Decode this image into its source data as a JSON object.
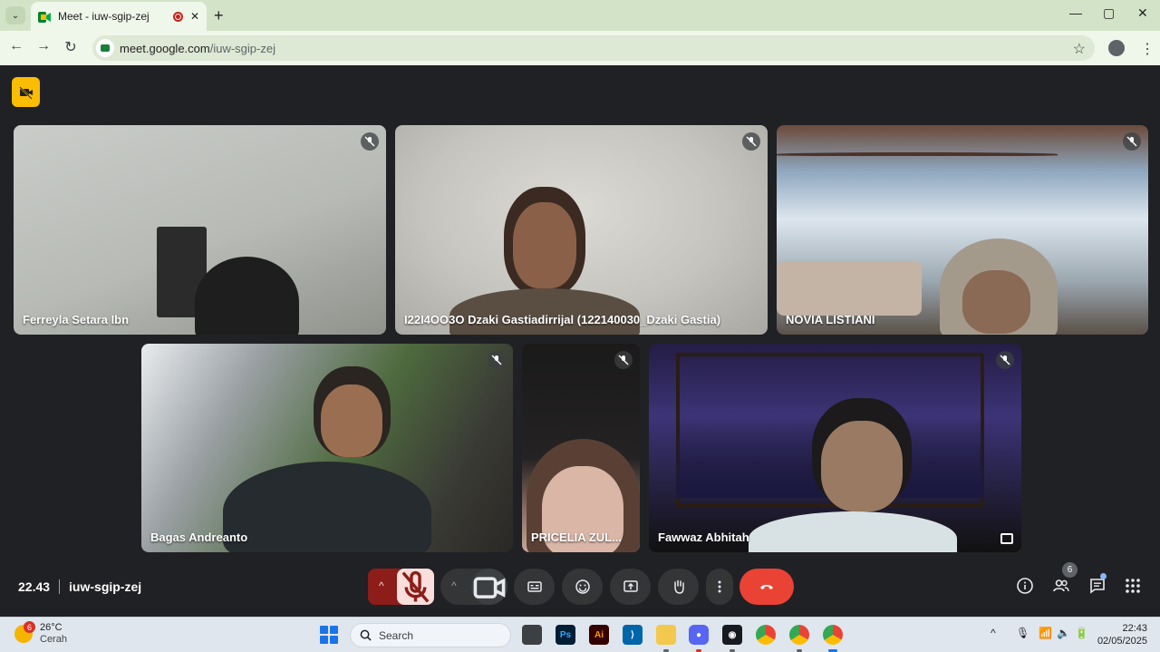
{
  "browser": {
    "tab_title": "Meet - iuw-sgip-zej",
    "url_host": "meet.google.com",
    "url_path": "/iuw-sgip-zej",
    "tab_close": "✕",
    "new_tab": "+",
    "minimize": "—",
    "maximize": "▢",
    "close_window": "✕"
  },
  "meet": {
    "time": "22.43",
    "meeting_code": "iuw-sgip-zej",
    "participant_count": "6",
    "tiles": [
      {
        "name": "Ferreyla Setara Ibn"
      },
      {
        "name": "I22I4OO3O Dzaki Gastiadirrijal (122140030_Dzaki Gastia)"
      },
      {
        "name": "NOVIA LISTIANI"
      },
      {
        "name": "Bagas Andreanto"
      },
      {
        "name": "PRICELIA ZUL..."
      },
      {
        "name": "Fawwaz Abhitah"
      }
    ],
    "colors": {
      "accent_yellow": "#fbbc04",
      "end_call": "#ea4335",
      "mic_off_bg": "#f9dedc"
    }
  },
  "taskbar": {
    "weather_temp": "26°C",
    "weather_cond": "Cerah",
    "weather_badge": "6",
    "search_label": "Search",
    "clock_time": "22:43",
    "clock_date": "02/05/2025"
  }
}
